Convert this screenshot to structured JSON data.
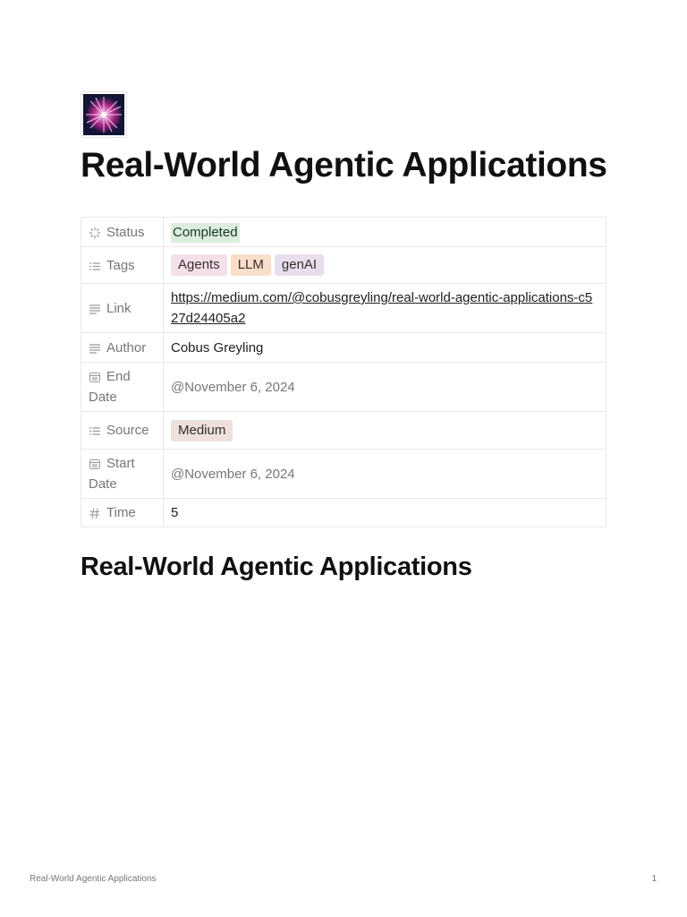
{
  "page": {
    "title": "Real-World Agentic Applications",
    "icon": "firework-icon"
  },
  "properties": {
    "status": {
      "label": "Status",
      "icon": "status-spinner-icon",
      "value": "Completed",
      "color": "#dbeddb"
    },
    "tags": {
      "label": "Tags",
      "icon": "list-icon",
      "values": [
        "Agents",
        "LLM",
        "genAI"
      ],
      "colors": [
        "#f5e0e9",
        "#fadec9",
        "#e8deee"
      ]
    },
    "link": {
      "label": "Link",
      "icon": "text-lines-icon",
      "value": "https://medium.com/@cobusgreyling/real-world-agentic-applications-c527d24405a2"
    },
    "author": {
      "label": "Author",
      "icon": "text-lines-icon",
      "value": "Cobus Greyling"
    },
    "end_date": {
      "label": "End Date",
      "icon": "calendar-icon",
      "value": "@November 6, 2024"
    },
    "source": {
      "label": "Source",
      "icon": "list-icon",
      "value": "Medium",
      "color": "#eee0da"
    },
    "start_date": {
      "label": "Start Date",
      "icon": "calendar-icon",
      "value": "@November 6, 2024"
    },
    "time": {
      "label": "Time",
      "icon": "hash-icon",
      "value": "5"
    }
  },
  "content": {
    "heading": "Real-World Agentic Applications"
  },
  "footer": {
    "title": "Real-World Agentic Applications",
    "page_number": "1"
  }
}
